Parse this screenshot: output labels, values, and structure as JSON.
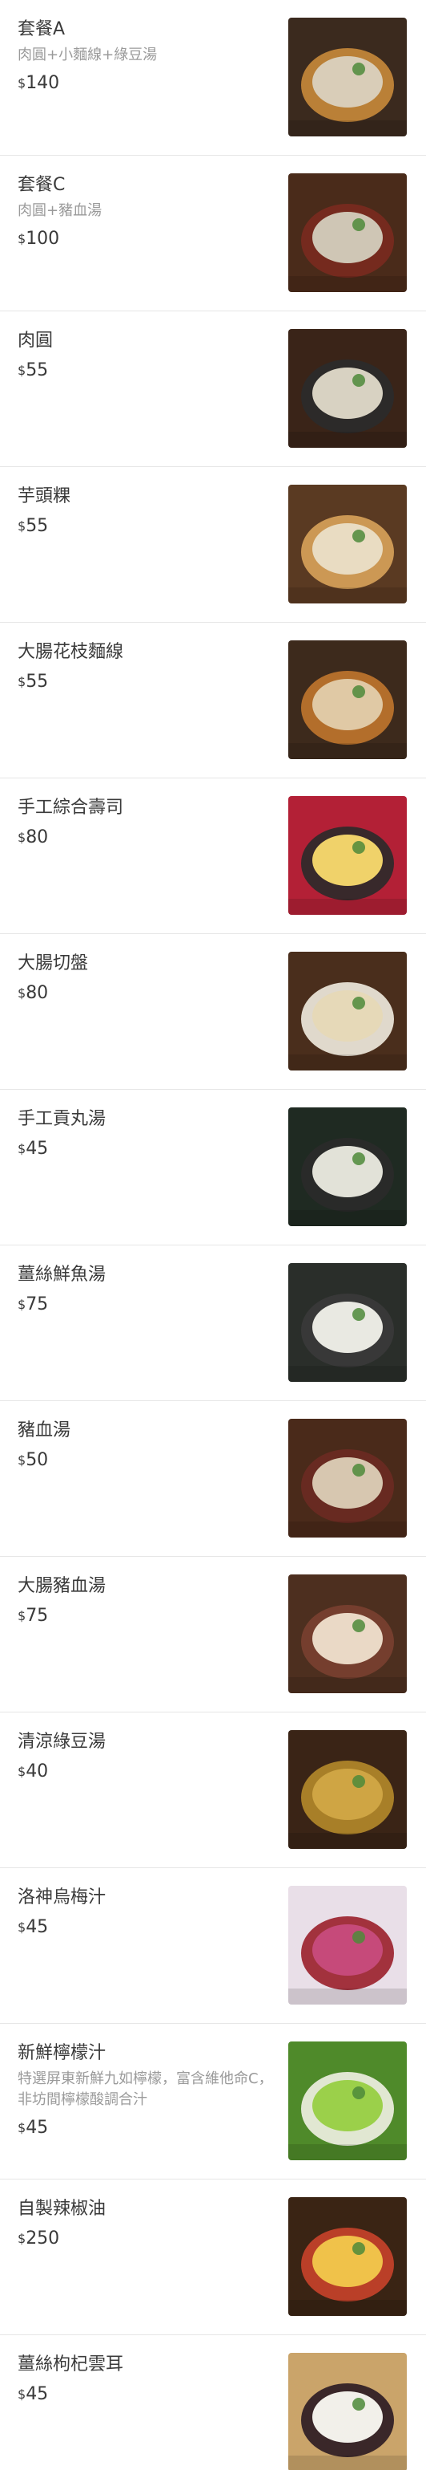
{
  "currency_symbol": "$",
  "items": [
    {
      "name": "套餐A",
      "desc": "肉圓+小麵線+綠豆湯",
      "price": "140",
      "image_icon": "meal-set-a-photo",
      "colors": {
        "bg": "#3b2a1e",
        "accent": "#c98a3a",
        "light": "#d9cdb8"
      }
    },
    {
      "name": "套餐C",
      "desc": "肉圓+豬血湯",
      "price": "100",
      "image_icon": "meal-set-c-photo",
      "colors": {
        "bg": "#4a2b1a",
        "accent": "#7a2a1f",
        "light": "#cfc6b5"
      }
    },
    {
      "name": "肉圓",
      "desc": "",
      "price": "55",
      "image_icon": "meatball-photo",
      "colors": {
        "bg": "#3a2418",
        "accent": "#2b2b2b",
        "light": "#d8d2c2"
      }
    },
    {
      "name": "芋頭粿",
      "desc": "",
      "price": "55",
      "image_icon": "taro-cake-photo",
      "colors": {
        "bg": "#5a3a22",
        "accent": "#d8a35a",
        "light": "#e9dcc2"
      }
    },
    {
      "name": "大腸花枝麵線",
      "desc": "",
      "price": "55",
      "image_icon": "intestine-noodle-photo",
      "colors": {
        "bg": "#3d2a1c",
        "accent": "#c0762e",
        "light": "#e0c9a5"
      }
    },
    {
      "name": "手工綜合壽司",
      "desc": "",
      "price": "80",
      "image_icon": "sushi-photo",
      "colors": {
        "bg": "#b32036",
        "accent": "#2a2a2a",
        "light": "#f0d26a"
      }
    },
    {
      "name": "大腸切盤",
      "desc": "",
      "price": "80",
      "image_icon": "intestine-platter-photo",
      "colors": {
        "bg": "#4a2e1c",
        "accent": "#f1ece0",
        "light": "#e6d9b8"
      }
    },
    {
      "name": "手工貢丸湯",
      "desc": "",
      "price": "45",
      "image_icon": "meatball-soup-photo",
      "colors": {
        "bg": "#1f2a22",
        "accent": "#2a2a2a",
        "light": "#e2e2d8"
      }
    },
    {
      "name": "薑絲鮮魚湯",
      "desc": "",
      "price": "75",
      "image_icon": "fish-soup-photo",
      "colors": {
        "bg": "#2a2e2a",
        "accent": "#3a3a3a",
        "light": "#e9e9e2"
      }
    },
    {
      "name": "豬血湯",
      "desc": "",
      "price": "50",
      "image_icon": "pig-blood-soup-photo",
      "colors": {
        "bg": "#4a2a1a",
        "accent": "#6b2a22",
        "light": "#d7c7b0"
      }
    },
    {
      "name": "大腸豬血湯",
      "desc": "",
      "price": "75",
      "image_icon": "intestine-blood-soup-photo",
      "colors": {
        "bg": "#4d2f1f",
        "accent": "#7a4030",
        "light": "#ead9c6"
      }
    },
    {
      "name": "清涼綠豆湯",
      "desc": "",
      "price": "40",
      "image_icon": "mung-bean-soup-photo",
      "colors": {
        "bg": "#3a2416",
        "accent": "#b58a2a",
        "light": "#cfa544"
      }
    },
    {
      "name": "洛神烏梅汁",
      "desc": "",
      "price": "45",
      "image_icon": "roselle-plum-juice-photo",
      "colors": {
        "bg": "#e9dfe8",
        "accent": "#9a1f2a",
        "light": "#c64a7a"
      }
    },
    {
      "name": "新鮮檸檬汁",
      "desc": "特選屏東新鮮九如檸檬，富含維他命C，非坊間檸檬酸調合汁",
      "price": "45",
      "image_icon": "lemon-juice-photo",
      "colors": {
        "bg": "#4f8a2a",
        "accent": "#f1f1e4",
        "light": "#9bd04a"
      }
    },
    {
      "name": "自製辣椒油",
      "desc": "",
      "price": "250",
      "image_icon": "chili-oil-photo",
      "colors": {
        "bg": "#3a2414",
        "accent": "#c9422a",
        "light": "#f0c24a"
      }
    },
    {
      "name": "薑絲枸杞雲耳",
      "desc": "",
      "price": "45",
      "image_icon": "wood-ear-photo",
      "colors": {
        "bg": "#caa46a",
        "accent": "#2a1a22",
        "light": "#f2f0ea"
      }
    }
  ]
}
